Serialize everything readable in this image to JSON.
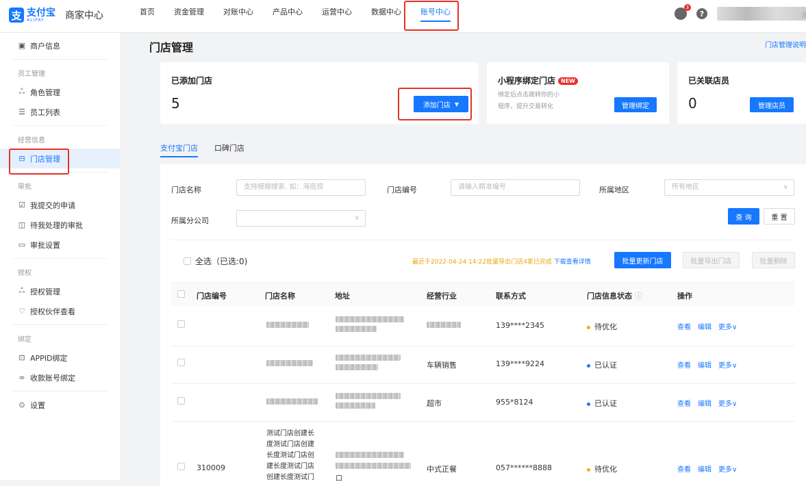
{
  "brand": {
    "logo_cn": "支付宝",
    "logo_en": "ALIPAY",
    "title": "商家中心"
  },
  "nav": [
    "首页",
    "资金管理",
    "对账中心",
    "产品中心",
    "运营中心",
    "数据中心",
    "账号中心"
  ],
  "nav_active": "账号中心",
  "topbar": {
    "bell_count": "3",
    "user_tail": "注"
  },
  "sidebar": {
    "merchant_info": "商户信息",
    "group_staff": "员工管理",
    "role_mgmt": "角色管理",
    "staff_list": "员工列表",
    "group_business": "经营信息",
    "store_mgmt": "门店管理",
    "group_approval": "审批",
    "my_submitted": "我提交的申请",
    "pending_approval": "待我处理的审批",
    "approval_settings": "审批设置",
    "group_auth": "授权",
    "auth_mgmt": "授权管理",
    "auth_partner": "授权伙伴查看",
    "group_bind": "绑定",
    "appid_bind": "APPID绑定",
    "account_bind": "收款账号绑定",
    "settings": "设置"
  },
  "page": {
    "title": "门店管理",
    "help_link": "门店管理说明"
  },
  "cards": {
    "added": {
      "title": "已添加门店",
      "count": "5",
      "button": "添加门店"
    },
    "miniapp": {
      "title": "小程序绑定门店",
      "badge": "NEW",
      "desc1": "绑定后点击跳转你的小",
      "desc2": "程序，提升交易转化",
      "button": "管理绑定"
    },
    "staff": {
      "title": "已关联店员",
      "count": "0",
      "button": "管理店员"
    }
  },
  "tabs": [
    "支付宝门店",
    "口碑门店"
  ],
  "filters": {
    "name_label": "门店名称",
    "name_placeholder": "支持模糊搜索, 如：海底捞",
    "code_label": "门店编号",
    "code_placeholder": "请输入精准编号",
    "region_label": "所属地区",
    "region_placeholder": "所有地区",
    "branch_label": "所属分公司",
    "query": "查 询",
    "reset": "重 置"
  },
  "bulk": {
    "select_all": "全选（已选:0)",
    "notice": "最近于2022-04-24 14:22批量导出门店4家已完成",
    "notice_link": "下载查看详情",
    "update": "批量更新门店",
    "export": "批量导出门店",
    "delete": "批量删除"
  },
  "table": {
    "headers": [
      "门店编号",
      "门店名称",
      "地址",
      "经营行业",
      "联系方式",
      "门店信息状态",
      "操作"
    ],
    "rows": [
      {
        "code": "",
        "industry": "",
        "phone": "139****2345",
        "status": "待优化",
        "status_color": "#f5a623"
      },
      {
        "code": "",
        "industry": "车辆销售",
        "phone": "139****9224",
        "status": "已认证",
        "status_color": "#1677ff"
      },
      {
        "code": "",
        "industry": "超市",
        "phone": "955*8124",
        "status": "已认证",
        "status_color": "#1677ff"
      },
      {
        "code": "310009",
        "industry": "中式正餐",
        "phone": "057******8888",
        "status": "待优化",
        "status_color": "#f5a623"
      }
    ],
    "row4_name_lines": [
      "测试门店创建长",
      "度测试门店创建",
      "长度测试门店创",
      "建长度测试门店",
      "创建长度测试门"
    ],
    "row4_addr_end": "口",
    "ops": {
      "view": "查看",
      "edit": "编辑",
      "more": "更多∨"
    }
  }
}
